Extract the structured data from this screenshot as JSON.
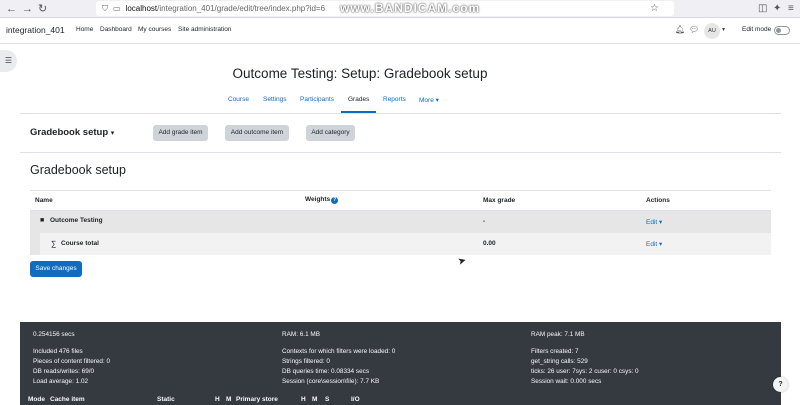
{
  "browser": {
    "url_host": "localhost",
    "url_path": "/integration_401/grade/edit/tree/index.php?id=6",
    "watermark": "www.BANDICAM.com"
  },
  "header": {
    "site_name": "integration_401",
    "nav": [
      "Home",
      "Dashboard",
      "My courses",
      "Site administration"
    ],
    "avatar_initials": "AU",
    "edit_mode_label": "Edit mode"
  },
  "page": {
    "title": "Outcome Testing: Setup: Gradebook setup"
  },
  "tabs": [
    {
      "label": "Course",
      "active": false
    },
    {
      "label": "Settings",
      "active": false
    },
    {
      "label": "Participants",
      "active": false
    },
    {
      "label": "Grades",
      "active": true
    },
    {
      "label": "Reports",
      "active": false
    },
    {
      "label": "More",
      "active": false
    }
  ],
  "toolbar": {
    "select_label": "Gradebook setup",
    "add_grade_item": "Add grade item",
    "add_outcome_item": "Add outcome item",
    "add_category": "Add category"
  },
  "main": {
    "heading": "Gradebook setup"
  },
  "table": {
    "headers": {
      "name": "Name",
      "weights": "Weights",
      "max_grade": "Max grade",
      "actions": "Actions"
    },
    "rows": [
      {
        "name": "Outcome Testing",
        "max_grade": "-",
        "action": "Edit"
      },
      {
        "name": "Course total",
        "max_grade": "0.00",
        "action": "Edit"
      }
    ]
  },
  "save_button": "Save changes",
  "footer": {
    "col1": [
      "0.254156 secs",
      "Included 476 files",
      "Pieces of content filtered: 0",
      "DB reads/writes: 69/0",
      "Load average: 1.02"
    ],
    "col2": [
      "RAM: 6.1 MB",
      "Contexts for which filters were loaded: 0",
      "Strings filtered: 0",
      "DB queries time: 0.08334 secs",
      "Session (core\\session\\file): 7.7 KB"
    ],
    "col3": [
      "RAM peak: 7.1 MB",
      "Filters created: 7",
      "get_string calls: 529",
      "ticks: 26 user: 7sys: 2 cuser: 0 csys: 0",
      "Session wait: 0.000 secs"
    ],
    "perf_headers": [
      "Mode",
      "Cache item",
      "Static",
      "H",
      "M",
      "Primary store",
      "H",
      "M",
      "S",
      "I/O"
    ]
  },
  "help_fab": "?"
}
